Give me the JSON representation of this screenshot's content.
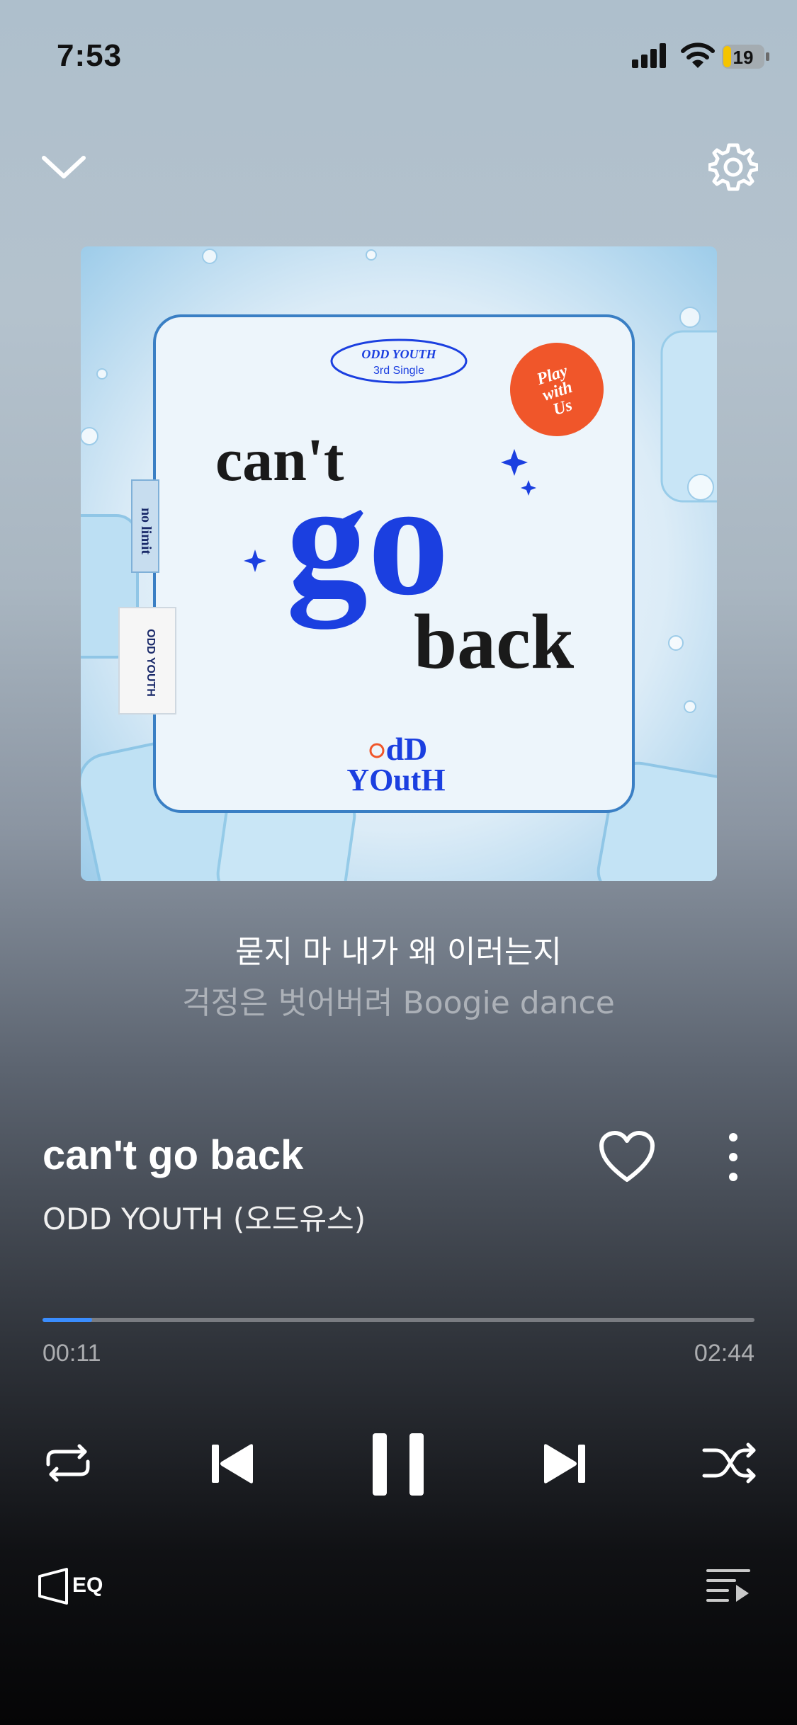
{
  "status_bar": {
    "time": "7:53",
    "battery_level": "19"
  },
  "album_art": {
    "badge_top": "ODD YOUTH",
    "badge_sub": "3rd Single",
    "title_line1": "can't",
    "title_line2": "go",
    "title_line3": "back",
    "sticker": [
      "Play",
      "with",
      "Us"
    ],
    "side_tag1": "no limit",
    "side_tag2": "ODD YOUTH",
    "logo_line1": "dD",
    "logo_line2": "YOutH",
    "accent_color": "#1b3fe0",
    "sticker_color": "#f0562a"
  },
  "lyrics": {
    "current": "묻지 마 내가 왜 이러는지",
    "next": "걱정은 벗어버려 Boogie dance"
  },
  "track": {
    "title": "can't go back",
    "artist": "ODD YOUTH (오드유스)",
    "elapsed": "00:11",
    "duration": "02:44",
    "progress": 0.07
  },
  "controls": {
    "eq_label": "EQ",
    "progress_color": "#3a8dff"
  }
}
